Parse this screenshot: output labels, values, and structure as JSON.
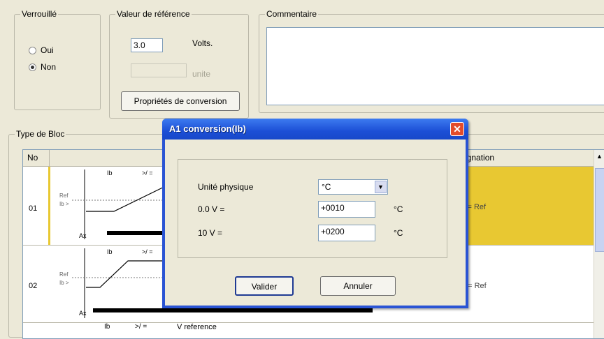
{
  "verrouille": {
    "legend": "Verrouillé",
    "oui": "Oui",
    "non": "Non",
    "selected": "Non"
  },
  "valeur_ref": {
    "legend": "Valeur de référence",
    "value": "3.0",
    "unit_label": "Volts.",
    "unite_placeholder": "unite",
    "conv_button": "Propriétés de conversion"
  },
  "commentaire": {
    "legend": "Commentaire",
    "value": ""
  },
  "type_bloc": {
    "legend": "Type de Bloc",
    "columns": [
      "No",
      "",
      "Désignation"
    ],
    "rows": [
      {
        "no": "01",
        "desc": "c= Ref",
        "graph_top": "Ib",
        "graph_sym": ">/ =",
        "ref": "Ref",
        "ib": "Ib >",
        "ax": "Ax"
      },
      {
        "no": "02",
        "desc": "b= Ref",
        "graph_top": "Ib",
        "graph_sym": ">/ =",
        "ref": "Ref",
        "ib": "Ib >",
        "ax": "Ax"
      },
      {
        "no": "",
        "desc": "",
        "graph_top": "Ib",
        "graph_sym": ">/ =",
        "ref": "V reference"
      }
    ],
    "header_right": "ignation"
  },
  "dialog": {
    "title": "A1 conversion(Ib)",
    "close": "✕",
    "unite_label": "Unité physique",
    "unite_value": "°C",
    "v0_label": "0.0 V =",
    "v0_value": "+0010",
    "v0_unit": "°C",
    "v10_label": "10 V =",
    "v10_value": "+0200",
    "v10_unit": "°C",
    "valider": "Valider",
    "annuler": "Annuler"
  },
  "colors": {
    "selected_row": "#e8c832",
    "titlebar": "#2a54d4"
  }
}
